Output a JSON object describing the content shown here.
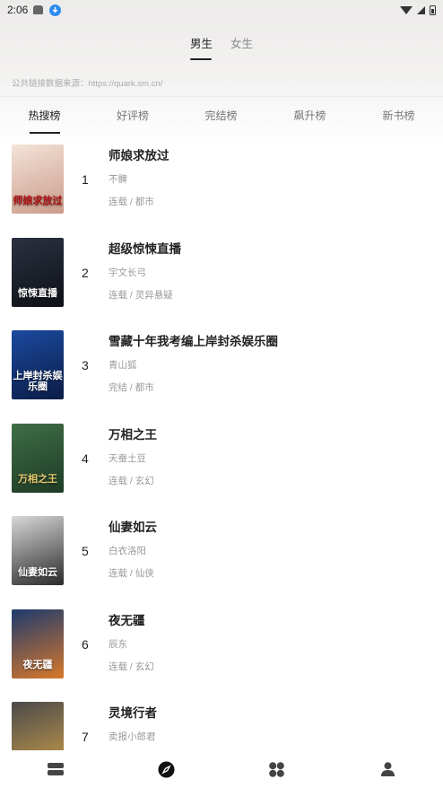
{
  "status_bar": {
    "time": "2:06"
  },
  "gender_tabs": [
    {
      "label": "男生",
      "active": true
    },
    {
      "label": "女生",
      "active": false
    }
  ],
  "source_note": "公共链接数据来源：https://quark.sm.cn/",
  "rank_tabs": [
    {
      "label": "热搜榜",
      "active": true
    },
    {
      "label": "好评榜",
      "active": false
    },
    {
      "label": "完结榜",
      "active": false
    },
    {
      "label": "飙升榜",
      "active": false
    },
    {
      "label": "新书榜",
      "active": false
    }
  ],
  "books": [
    {
      "rank": "1",
      "title": "师娘求放过",
      "author": "不髀",
      "meta": "连载 / 都市",
      "cover_text": "师娘求放过",
      "cover_colors": [
        "#f4e3d8",
        "#c99b8a"
      ],
      "cover_text_color": "#b01010"
    },
    {
      "rank": "2",
      "title": "超级惊悚直播",
      "author": "宇文长弓",
      "meta": "连载 / 灵异悬疑",
      "cover_text": "惊悚直播",
      "cover_colors": [
        "#2a3140",
        "#0e1016"
      ],
      "cover_text_color": "#ffffff"
    },
    {
      "rank": "3",
      "title": "雪藏十年我考编上岸封杀娱乐圈",
      "author": "青山狐",
      "meta": "完结 / 都市",
      "cover_text": "上岸封杀娱乐圈",
      "cover_colors": [
        "#1b4aa0",
        "#0b1c45"
      ],
      "cover_text_color": "#ffffff"
    },
    {
      "rank": "4",
      "title": "万相之王",
      "author": "天蚕土豆",
      "meta": "连载 / 玄幻",
      "cover_text": "万相之王",
      "cover_colors": [
        "#3f6e45",
        "#1e3b25"
      ],
      "cover_text_color": "#e6c86e"
    },
    {
      "rank": "5",
      "title": "仙妻如云",
      "author": "白衣洛阳",
      "meta": "连载 / 仙侠",
      "cover_text": "仙妻如云",
      "cover_colors": [
        "#d8d8d8",
        "#2a2a2a"
      ],
      "cover_text_color": "#ffffff"
    },
    {
      "rank": "6",
      "title": "夜无疆",
      "author": "辰东",
      "meta": "连载 / 玄幻",
      "cover_text": "夜无疆",
      "cover_colors": [
        "#1d3a6e",
        "#d8782a"
      ],
      "cover_text_color": "#ffffff"
    },
    {
      "rank": "7",
      "title": "灵境行者",
      "author": "卖报小郎君",
      "meta": "",
      "cover_text": "",
      "cover_colors": [
        "#4a4a4a",
        "#c79a4a"
      ],
      "cover_text_color": "#ffffff"
    }
  ],
  "bottom_nav": [
    {
      "icon": "bookshelf-icon",
      "active": false
    },
    {
      "icon": "compass-icon",
      "active": true
    },
    {
      "icon": "category-icon",
      "active": false
    },
    {
      "icon": "profile-icon",
      "active": false
    }
  ],
  "colors": {
    "primary_text": "#222222",
    "secondary_text": "#999999",
    "accent_blue": "#2e8cf0"
  }
}
